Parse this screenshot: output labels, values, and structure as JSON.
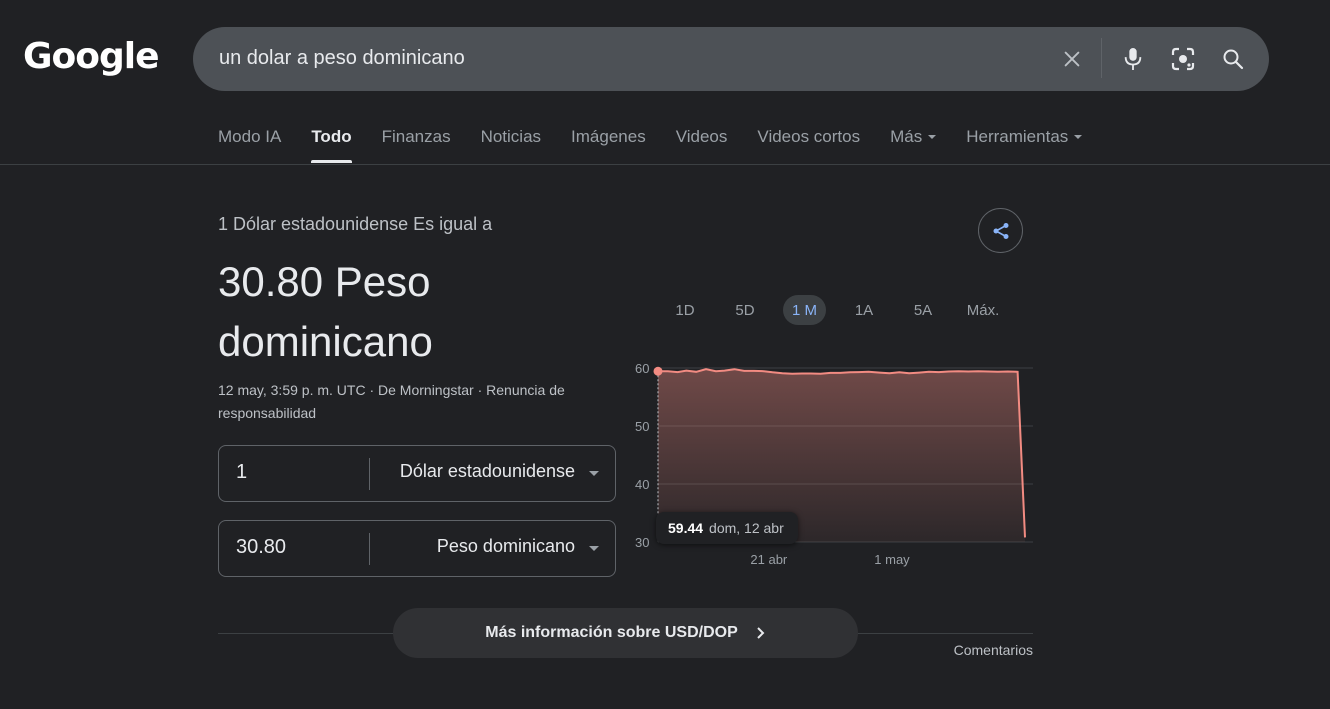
{
  "header": {
    "logo": "Google",
    "search_query": "un dolar a peso dominicano",
    "icons": {
      "clear": "close-icon",
      "voice": "microphone-icon",
      "lens": "lens-icon",
      "search": "search-icon"
    }
  },
  "tabs": [
    {
      "label": "Modo IA",
      "active": false
    },
    {
      "label": "Todo",
      "active": true
    },
    {
      "label": "Finanzas",
      "active": false
    },
    {
      "label": "Noticias",
      "active": false
    },
    {
      "label": "Imágenes",
      "active": false
    },
    {
      "label": "Videos",
      "active": false
    },
    {
      "label": "Videos cortos",
      "active": false
    },
    {
      "label": "Más",
      "active": false,
      "dropdown": true
    },
    {
      "label": "Herramientas",
      "active": false,
      "dropdown": true
    }
  ],
  "converter": {
    "lead": "1 Dólar estadounidense Es igual a",
    "result": "30.80 Peso dominicano",
    "meta": "12 may, 3:59 p. m. UTC · De Morningstar · Renuncia de responsabilidad",
    "from": {
      "amount": "1",
      "currency": "Dólar estadounidense"
    },
    "to": {
      "amount": "30.80",
      "currency": "Peso dominicano"
    }
  },
  "ranges": [
    {
      "label": "1D",
      "active": false
    },
    {
      "label": "5D",
      "active": false
    },
    {
      "label": "1 M",
      "active": true
    },
    {
      "label": "1A",
      "active": false
    },
    {
      "label": "5A",
      "active": false
    },
    {
      "label": "Máx.",
      "active": false
    }
  ],
  "tooltip": {
    "value": "59.44",
    "date": "dom, 12 abr"
  },
  "chart_data": {
    "type": "area",
    "ylim": [
      30,
      60
    ],
    "yticks": [
      "60",
      "50",
      "40",
      "30"
    ],
    "ytick_values": [
      60,
      50,
      40,
      30
    ],
    "xticks": [
      {
        "label": "21 abr",
        "day": 9
      },
      {
        "label": "1 may",
        "day": 19
      }
    ],
    "x_days": [
      0,
      0.8,
      1.6,
      2.3,
      3.1,
      3.9,
      4.7,
      5.4,
      6.2,
      7.0,
      7.8,
      8.6,
      9.3,
      10.1,
      10.9,
      11.7,
      12.4,
      13.2,
      14.0,
      14.8,
      15.6,
      16.3,
      17.1,
      18.0,
      18.8,
      19.6,
      20.4,
      21.2,
      22.0,
      22.8,
      23.6,
      24.4,
      25.2,
      26.0,
      26.8,
      27.6,
      28.4,
      29.2,
      29.8
    ],
    "values": [
      59.44,
      59.44,
      59.3,
      59.55,
      59.35,
      59.8,
      59.45,
      59.55,
      59.8,
      59.5,
      59.5,
      59.45,
      59.25,
      59.1,
      59.0,
      59.05,
      59.05,
      59.0,
      59.15,
      59.15,
      59.25,
      59.3,
      59.35,
      59.2,
      59.1,
      59.25,
      59.1,
      59.2,
      59.35,
      59.3,
      59.4,
      59.45,
      59.4,
      59.45,
      59.4,
      59.35,
      59.4,
      59.35,
      30.8
    ],
    "series_color": "#f28b82",
    "highlight": {
      "value": 59.44,
      "date": "dom, 12 abr"
    },
    "grid": true
  },
  "actions": {
    "more_info": "Más información sobre USD/DOP",
    "feedback": "Comentarios"
  }
}
